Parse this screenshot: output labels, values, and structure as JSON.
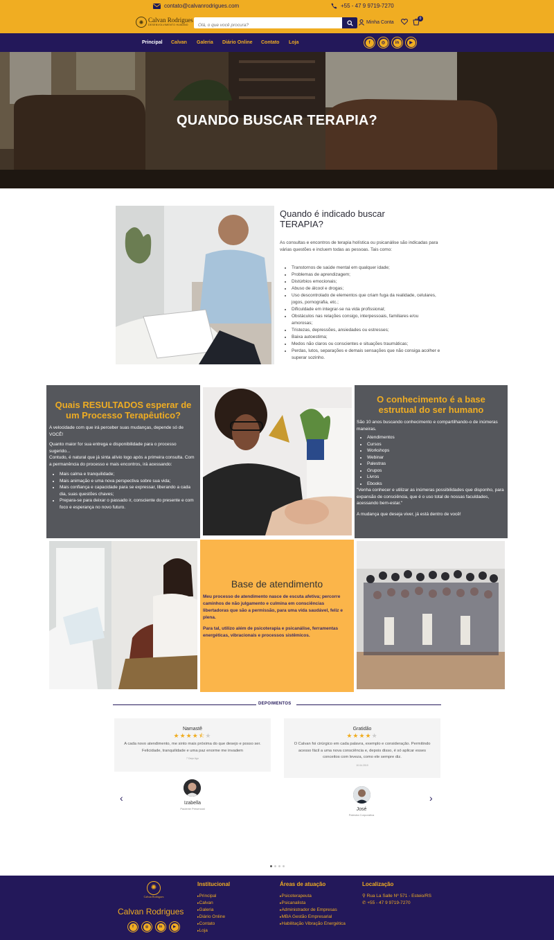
{
  "header": {
    "email": "contato@calvanrodrigues.com",
    "phone": "+55 - 47 9 9719-7270",
    "logo_name": "Calvan Rodrigues",
    "logo_tagline": "DESENVOLVIMENTO HUMANO",
    "search_placeholder": "Olá, o que você procura?",
    "account_label": "Minha Conta",
    "cart_count": "0"
  },
  "nav": {
    "items": [
      "Principal",
      "Calvan",
      "Galeria",
      "Diário Online",
      "Contato",
      "Loja"
    ],
    "active": "Principal",
    "social": [
      "facebook-icon",
      "instagram-icon",
      "linkedin-icon",
      "youtube-icon"
    ]
  },
  "hero": {
    "title": "QUANDO BUSCAR TERAPIA?"
  },
  "therapy": {
    "title_line1": "Quando é indicado buscar",
    "title_line2": "TERAPIA?",
    "intro": "As consultas e encontros de terapia holística ou psicanálise são indicadas para várias questões e incluem todas as pessoas. Tais como:",
    "items": [
      "Transtornos de saúde mental em qualquer idade;",
      "Problemas de aprendizagem;",
      "Distúrbios emocionais;",
      "Abuso de álcool e drogas;",
      "Uso descontrolado de elementos que criam fuga da realidade, celulares, jogos, pornografia, etc.;",
      "Dificuldade em integrar-se na vida profissional;",
      "Obstáculos nas relações consigo, interpessoais, familiares e/ou amorosas;",
      "Tristezas, depressões, ansiedades ou estresses;",
      "Baixa autoestima;",
      "Medos não claros ou conscientes e situações traumáticas;",
      "Perdas, lutos, separações e demais sensações que não consiga acolher e superar sozinho."
    ]
  },
  "results": {
    "title": "Quais RESULTADOS esperar de um Processo Terapêutico?",
    "p1": "A velocidade com que irá perceber suas mudanças, depende só de VOCÊ!",
    "p2": "Quanto maior for sua entrega e disponibilidade para o processo sugerido...",
    "p3": "Contudo, é natural que já sinta alívio logo após a primeira consulta. Com a permanência do processo e mais encontros, irá acessando:",
    "items": [
      "Mais calma e tranquilidade;",
      "Mais animação e uma nova perspectiva sobre sua vida;",
      "Mais confiança e capacidade para se expressar, liberando a cada dia, suas questões chaves;",
      "Prepara-se para deixar o passado ir, consciente do presente e com foco e esperança no novo futuro."
    ]
  },
  "knowledge": {
    "title": "O conhecimento é a base estrutual do ser humano",
    "p1": "São 10 anos buscando conhecimento e compartilhando-o de inúmeras maneiras.",
    "items": [
      "Atendimentos",
      "Cursos",
      "Workshops",
      "Webinar",
      "Palestras",
      "Grupos",
      "Livros",
      "Ebooks"
    ],
    "quote": "\"Venha conhecer e utilizar as inúmeras possibilidades que disponho, para expansão de consciência, que é o uso total de nossas faculdades, acessando bem-estar.\"",
    "closing": "A mudança que deseja viver, já está dentro de você!"
  },
  "base": {
    "title": "Base de atendimento",
    "p1": "Meu processo de atendimento nasce de escuta afetiva; percorre caminhos de não julgamento e culmina em consciências libertadoras que são a permissão, para uma vida saudável, feliz e plena.",
    "p2": "Para tal, utilizo além de psicoterapia e psicanálise, ferramentas energéticas, vibracionais e processos sistêmicos."
  },
  "testimonials": {
    "title": "DEPOIMENTOS",
    "cards": [
      {
        "heading": "Namastê",
        "rating": 4.5,
        "text": "A cada novo atendimento, me sinto mais próxima do que desejo e posso ser. Felicidade, tranquilidade e uma paz enorme me invadem",
        "date": "7 Days Ago",
        "name": "Izabella",
        "role": "Paciente Presencial"
      },
      {
        "heading": "Gratidão",
        "rating": 4,
        "text": "O Calvan foi cirúrgico em cada palavra, exemplo e consideração. Permitindo acesso fácil a uma nova consciência e, depois disso, é só aplicar esses conceitos com leveza, como ele sempre diz.",
        "date": "10.04.2019",
        "name": "José",
        "role": "Palestra Corporativa"
      }
    ]
  },
  "footer": {
    "brand": "Calvan Rodrigues",
    "logo_name": "Calvan Rodrigues",
    "institutional_title": "Institucional",
    "institutional": [
      "Principal",
      "Calvan",
      "Galeria",
      "Diário Online",
      "Contato",
      "Loja"
    ],
    "areas_title": "Áreas de atuação",
    "areas": [
      "Psicoterapeuta",
      "Psicanalista",
      "Administrador de Empresas",
      "MBA Gestão Empresarial",
      "Habilitação Vibração Energética"
    ],
    "location_title": "Localização",
    "address": "Rua La Salle Nº 571 - Esteio/RS",
    "phone": "+55 - 47 9 9719-7270"
  },
  "colors": {
    "gold": "#f0ad22",
    "navy": "#23185a",
    "gray_box": "#55575c",
    "light_gold_box": "#fbb54a"
  }
}
